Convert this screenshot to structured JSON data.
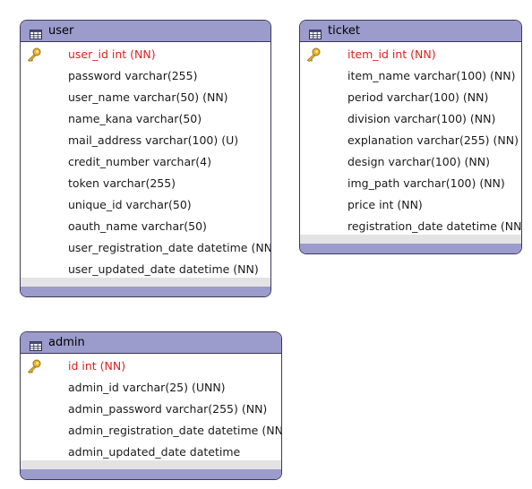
{
  "tables": [
    {
      "id": "user",
      "name": "user",
      "columns": [
        {
          "label": "user_id int (NN)",
          "pk": true
        },
        {
          "label": "password varchar(255)",
          "pk": false
        },
        {
          "label": "user_name varchar(50) (NN)",
          "pk": false
        },
        {
          "label": "name_kana varchar(50)",
          "pk": false
        },
        {
          "label": "mail_address varchar(100) (U)",
          "pk": false
        },
        {
          "label": "credit_number varchar(4)",
          "pk": false
        },
        {
          "label": "token varchar(255)",
          "pk": false
        },
        {
          "label": "unique_id varchar(50)",
          "pk": false
        },
        {
          "label": "oauth_name varchar(50)",
          "pk": false
        },
        {
          "label": "user_registration_date datetime (NN)",
          "pk": false
        },
        {
          "label": "user_updated_date datetime (NN)",
          "pk": false
        }
      ]
    },
    {
      "id": "ticket",
      "name": "ticket",
      "columns": [
        {
          "label": "item_id int (NN)",
          "pk": true
        },
        {
          "label": "item_name varchar(100) (NN)",
          "pk": false
        },
        {
          "label": "period varchar(100) (NN)",
          "pk": false
        },
        {
          "label": "division varchar(100) (NN)",
          "pk": false
        },
        {
          "label": "explanation varchar(255) (NN)",
          "pk": false
        },
        {
          "label": "design varchar(100) (NN)",
          "pk": false
        },
        {
          "label": "img_path varchar(100) (NN)",
          "pk": false
        },
        {
          "label": "price int (NN)",
          "pk": false
        },
        {
          "label": "registration_date datetime (NN)",
          "pk": false
        }
      ]
    },
    {
      "id": "admin",
      "name": "admin",
      "columns": [
        {
          "label": "id int (NN)",
          "pk": true
        },
        {
          "label": "admin_id varchar(25) (UNN)",
          "pk": false
        },
        {
          "label": "admin_password varchar(255) (NN)",
          "pk": false
        },
        {
          "label": "admin_registration_date datetime (NN)",
          "pk": false
        },
        {
          "label": "admin_updated_date datetime",
          "pk": false
        }
      ]
    }
  ],
  "colors": {
    "header": "#9b9bcc",
    "border": "#3a3a5c",
    "primary_key_text": "#e02020",
    "key_icon": "#e0b030"
  },
  "icons": {
    "table": "table-grid-icon",
    "primary_key": "key-icon"
  }
}
